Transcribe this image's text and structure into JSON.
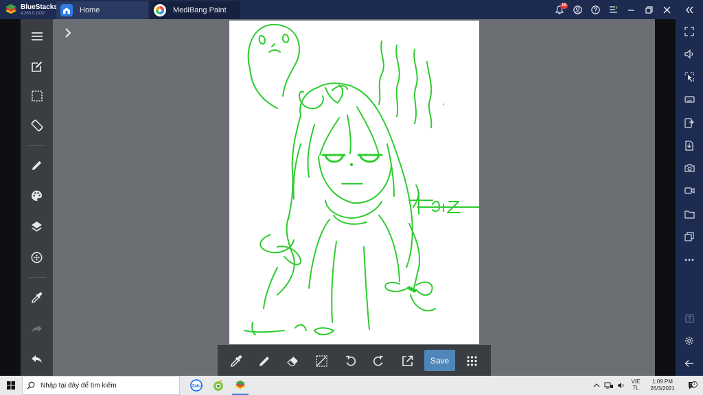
{
  "titlebar": {
    "brand_name": "BlueStacks",
    "brand_version": "4.260.0.1032",
    "tabs": [
      {
        "label": "Home"
      },
      {
        "label": "MediBang Paint"
      }
    ],
    "notification_count": "15"
  },
  "bottom_toolbar": {
    "save_label": "Save"
  },
  "taskbar": {
    "search_placeholder": "Nhập tại đây để tìm kiếm",
    "lang_top": "VIE",
    "lang_bottom": "TL",
    "time": "1:09 PM",
    "date": "26/3/2021",
    "notif_count": "1"
  },
  "colors": {
    "accent": "#4f86b9",
    "stroke": "#2ecc2e",
    "frame": "#1d2b51"
  }
}
